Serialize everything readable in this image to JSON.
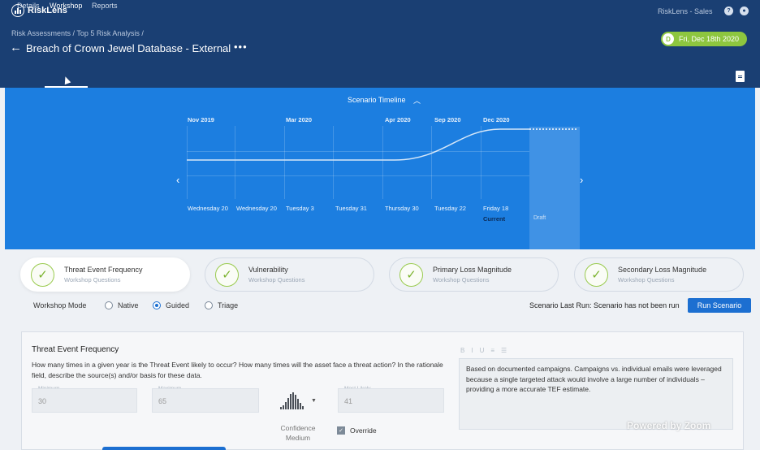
{
  "app": {
    "logo_text": "RiskLens",
    "org_label": "RiskLens - Sales",
    "user_initial": "D"
  },
  "breadcrumb": "Risk Assessments / Top 5 Risk Analysis /",
  "page_title": "Breach of Crown Jewel Database - External",
  "date_pill": {
    "initial": "D",
    "label": "Fri, Dec 18th 2020",
    "color": "#8dc63f"
  },
  "tabs": [
    {
      "label": "Details"
    },
    {
      "label": "Workshop",
      "active": true
    },
    {
      "label": "Reports"
    }
  ],
  "timeline": {
    "title": "Scenario Timeline",
    "months": [
      "Nov 2019",
      "Mar 2020",
      "Apr 2020",
      "Sep 2020",
      "Dec 2020"
    ],
    "days": [
      "Wednesday 20",
      "Wednesday 20",
      "Tuesday 3",
      "Tuesday 31",
      "Thursday 30",
      "Tuesday 22",
      "Friday 18"
    ],
    "current_label": "Current",
    "draft_label": "Draft",
    "color": "#1c7ee0"
  },
  "steps": [
    {
      "title": "Threat Event Frequency",
      "subtitle": "Workshop Questions",
      "active": true
    },
    {
      "title": "Vulnerability",
      "subtitle": "Workshop Questions"
    },
    {
      "title": "Primary Loss Magnitude",
      "subtitle": "Workshop Questions"
    },
    {
      "title": "Secondary Loss Magnitude",
      "subtitle": "Workshop Questions"
    }
  ],
  "workshop_mode": {
    "label": "Workshop Mode",
    "options": [
      "Native",
      "Guided",
      "Triage"
    ],
    "selected": "Guided"
  },
  "last_run": "Scenario Last Run: Scenario has not been run",
  "run_button": "Run Scenario",
  "panel": {
    "title": "Threat Event Frequency",
    "question": "How many times in a given year is the Threat Event likely to occur? How many times will the asset face a threat action? In the rationale field, describe the source(s) and/or basis for these data.",
    "minimum_label": "Minimum",
    "minimum_value": "30",
    "maximum_label": "Maximum",
    "maximum_value": "65",
    "most_likely_label": "Most Likely",
    "most_likely_value": "41",
    "confidence_label": "Confidence Medium",
    "override_label": "Override",
    "override_checked": true,
    "toolbar": [
      "B",
      "I",
      "U",
      "≡",
      "☰"
    ],
    "rationale": "Based on documented campaigns. Campaigns vs. individual emails were leveraged because a single targeted attack would involve a large number of individuals – providing a more accurate TEF estimate."
  },
  "watermark": "Powered by Zoom",
  "accent_color": "#1c6fd1"
}
